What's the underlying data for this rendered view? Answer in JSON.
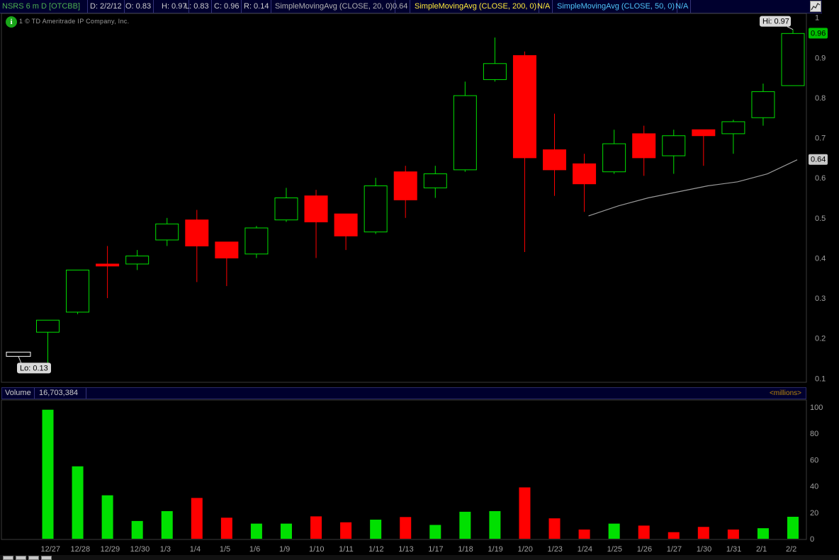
{
  "header": {
    "symbol": "NSRS 6 m D [OTCBB]",
    "date": "D: 2/2/12",
    "open": "O: 0.83",
    "high": "H: 0.97",
    "low": "L: 0.83",
    "close": "C: 0.96",
    "range": "R: 0.14",
    "sma20_label": "SimpleMovingAvg (CLOSE, 20, 0)",
    "sma20_value": "0.64",
    "sma200_label": "SimpleMovingAvg (CLOSE, 200, 0)",
    "sma200_value": "N/A",
    "sma50_label": "SimpleMovingAvg (CLOSE, 50, 0)",
    "sma50_value": "N/A",
    "colors": {
      "symbol": "#4caf50",
      "ohlc": "#d0d0d0",
      "sma20": "#b0b0b0",
      "sma200": "#ffeb3b",
      "sma50": "#4fc3f7"
    }
  },
  "copyright": {
    "icon": "info-icon",
    "icon_glyph": "i",
    "text": "1 © TD Ameritrade IP Company, Inc."
  },
  "volume_header": {
    "label": "Volume",
    "value": "16,703,384",
    "units": "<millions>"
  },
  "chart_data": [
    {
      "type": "candlestick",
      "title": "NSRS 6 m D [OTCBB]",
      "categories": [
        "12/27",
        "12/28",
        "12/29",
        "12/30",
        "1/3",
        "1/4",
        "1/5",
        "1/6",
        "1/9",
        "1/10",
        "1/11",
        "1/12",
        "1/13",
        "1/17",
        "1/18",
        "1/19",
        "1/20",
        "1/23",
        "1/24",
        "1/25",
        "1/26",
        "1/27",
        "1/30",
        "1/31",
        "2/1",
        "2/2"
      ],
      "open": [
        0.215,
        0.265,
        0.385,
        0.385,
        0.445,
        0.495,
        0.44,
        0.41,
        0.495,
        0.555,
        0.51,
        0.465,
        0.615,
        0.575,
        0.62,
        0.845,
        0.905,
        0.67,
        0.635,
        0.615,
        0.71,
        0.655,
        0.72,
        0.71,
        0.75,
        0.83
      ],
      "high": [
        0.24,
        0.27,
        0.43,
        0.42,
        0.5,
        0.52,
        0.44,
        0.48,
        0.575,
        0.57,
        0.51,
        0.6,
        0.63,
        0.63,
        0.84,
        0.95,
        0.915,
        0.76,
        0.66,
        0.72,
        0.73,
        0.72,
        0.72,
        0.745,
        0.835,
        0.97
      ],
      "low": [
        0.135,
        0.26,
        0.3,
        0.37,
        0.43,
        0.34,
        0.33,
        0.4,
        0.49,
        0.4,
        0.42,
        0.46,
        0.5,
        0.55,
        0.615,
        0.84,
        0.415,
        0.555,
        0.515,
        0.61,
        0.605,
        0.61,
        0.63,
        0.66,
        0.73,
        0.83
      ],
      "close": [
        0.245,
        0.37,
        0.38,
        0.405,
        0.485,
        0.43,
        0.4,
        0.475,
        0.55,
        0.49,
        0.455,
        0.58,
        0.545,
        0.61,
        0.805,
        0.885,
        0.65,
        0.62,
        0.585,
        0.685,
        0.65,
        0.705,
        0.705,
        0.74,
        0.815,
        0.96
      ],
      "y_ticks": [
        "0.1",
        "0.2",
        "0.3",
        "0.4",
        "0.5",
        "0.6",
        "0.7",
        "0.8",
        "0.9",
        "1"
      ],
      "ylim": [
        0.09,
        1.01
      ],
      "sma": {
        "name": "SimpleMovingAvg (CLOSE, 20, 0)",
        "start_index": 18,
        "values": [
          0.505,
          0.53,
          0.55,
          0.565,
          0.58,
          0.59,
          0.61,
          0.645
        ]
      },
      "annotations": {
        "hi_label": "Hi: 0.97",
        "hi_value": 0.97,
        "lo_label": "Lo: 0.13",
        "lo_value": 0.13,
        "last_price": "0.96",
        "sma_last": "0.64"
      },
      "colors": {
        "up": "#00e000",
        "down": "#ff0000",
        "sma": "#9a9a9a",
        "axis_text": "#a0a0a0",
        "hi_lo_box": "#d9d9d9",
        "last_box": "#00c000",
        "sma_box": "#c8c8c8"
      }
    },
    {
      "type": "bar",
      "title": "Volume",
      "categories": [
        "12/27",
        "12/28",
        "12/29",
        "12/30",
        "1/3",
        "1/4",
        "1/5",
        "1/6",
        "1/9",
        "1/10",
        "1/11",
        "1/12",
        "1/13",
        "1/17",
        "1/18",
        "1/19",
        "1/20",
        "1/23",
        "1/24",
        "1/25",
        "1/26",
        "1/27",
        "1/30",
        "1/31",
        "2/1",
        "2/2"
      ],
      "values": [
        98,
        55,
        33,
        13.5,
        21,
        31,
        16,
        11.5,
        11.5,
        17,
        12.5,
        14.5,
        16.5,
        10.5,
        20.5,
        21,
        39,
        15.5,
        7,
        11.5,
        10,
        5,
        9,
        7,
        8,
        16.7
      ],
      "direction": [
        "up",
        "up",
        "up",
        "up",
        "up",
        "down",
        "down",
        "up",
        "up",
        "down",
        "down",
        "up",
        "down",
        "up",
        "up",
        "up",
        "down",
        "down",
        "down",
        "up",
        "down",
        "down",
        "down",
        "down",
        "up",
        "up"
      ],
      "y_ticks": [
        "0",
        "20",
        "40",
        "60",
        "80",
        "100"
      ],
      "ylim": [
        0,
        100
      ],
      "ylabel": "<millions>"
    }
  ]
}
